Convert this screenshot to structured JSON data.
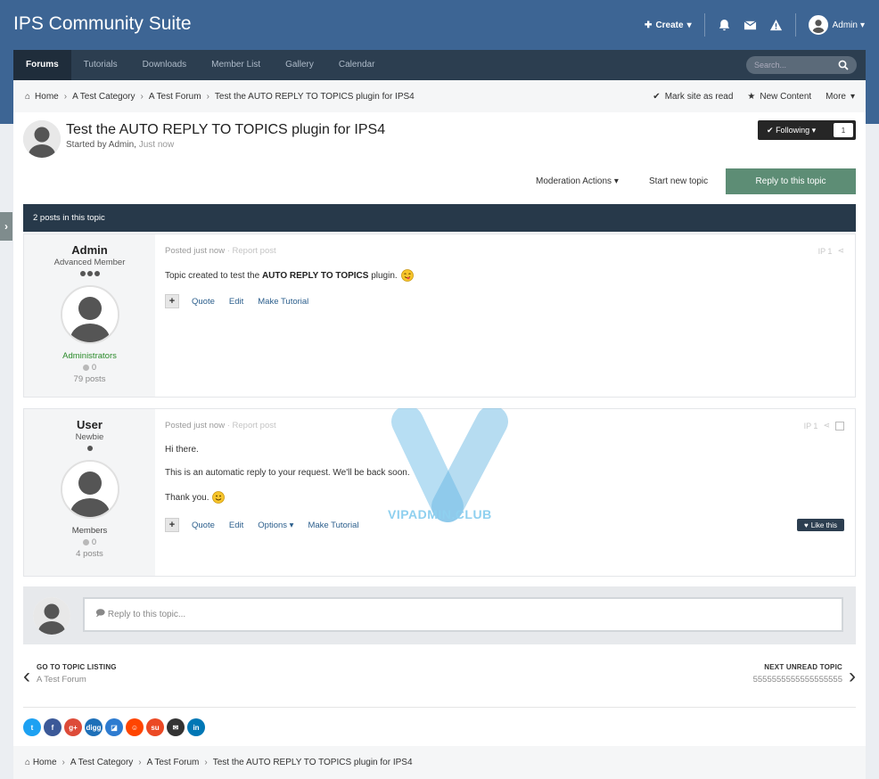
{
  "site": {
    "title": "IPS Community Suite"
  },
  "user_bar": {
    "create_label": "Create",
    "user_label": "Admin"
  },
  "nav": {
    "tabs": [
      {
        "label": "Forums"
      },
      {
        "label": "Tutorials"
      },
      {
        "label": "Downloads"
      },
      {
        "label": "Member List"
      },
      {
        "label": "Gallery"
      },
      {
        "label": "Calendar"
      }
    ],
    "search_placeholder": "Search..."
  },
  "breadcrumb": {
    "items": [
      "Home",
      "A Test Category",
      "A Test Forum",
      "Test the AUTO REPLY TO TOPICS plugin for IPS4"
    ],
    "mark_read": "Mark site as read",
    "new_content": "New Content",
    "more": "More"
  },
  "topic": {
    "title": "Test the AUTO REPLY TO TOPICS plugin for IPS4",
    "started_by": "Started by Admin,",
    "time": "Just now",
    "following_label": "Following",
    "following_count": "1",
    "moderation": "Moderation Actions",
    "start_new": "Start new topic",
    "reply": "Reply to this topic",
    "posts_count": "2 posts in this topic"
  },
  "posts": [
    {
      "author": "Admin",
      "rank": "Advanced Member",
      "group": "Administrators",
      "group_color": "#2a8a2a",
      "rep": "0",
      "postcount": "79 posts",
      "posted": "Posted just now",
      "report": "· Report post",
      "post_ref": "IP    1",
      "text_before": "Topic created to test the ",
      "text_bold": "AUTO REPLY TO TOPICS",
      "text_after": " plugin.",
      "actions": [
        "Quote",
        "Edit",
        "Make Tutorial"
      ]
    },
    {
      "author": "User",
      "rank": "Newbie",
      "group": "Members",
      "group_color": "#444444",
      "rep": "0",
      "postcount": "4 posts",
      "posted": "Posted just now",
      "report": "· Report post",
      "post_ref": "IP    1",
      "line1": "Hi there.",
      "line2": "This is an automatic reply to your request. We'll be back soon.",
      "line3": "Thank you.",
      "actions": [
        "Quote",
        "Edit",
        "Options",
        "Make Tutorial"
      ],
      "like": "Like this"
    }
  ],
  "reply_box": {
    "placeholder": "Reply to this topic..."
  },
  "pager": {
    "prev_title": "GO TO TOPIC LISTING",
    "prev_sub": "A Test Forum",
    "next_title": "NEXT UNREAD TOPIC",
    "next_sub": "5555555555555555555"
  },
  "watermark": {
    "text": "VIPADMIN.CLUB"
  },
  "share": [
    {
      "label": "t",
      "icon": "twitter-icon",
      "color": "#1da1f2"
    },
    {
      "label": "f",
      "icon": "facebook-icon",
      "color": "#3b5998"
    },
    {
      "label": "g+",
      "icon": "google-plus-icon",
      "color": "#dd4b39"
    },
    {
      "label": "digg",
      "icon": "digg-icon",
      "color": "#1d6fb8"
    },
    {
      "label": "◪",
      "icon": "delicious-icon",
      "color": "#2d7bd0"
    },
    {
      "label": "☺",
      "icon": "reddit-icon",
      "color": "#ff4500"
    },
    {
      "label": "su",
      "icon": "stumbleupon-icon",
      "color": "#eb4924"
    },
    {
      "label": "✉",
      "icon": "email-icon",
      "color": "#333333"
    },
    {
      "label": "in",
      "icon": "linkedin-icon",
      "color": "#0077b5"
    }
  ],
  "colors": {
    "header": "#3d6594",
    "nav": "#2c3e50",
    "reply_button": "#5d8d75"
  }
}
